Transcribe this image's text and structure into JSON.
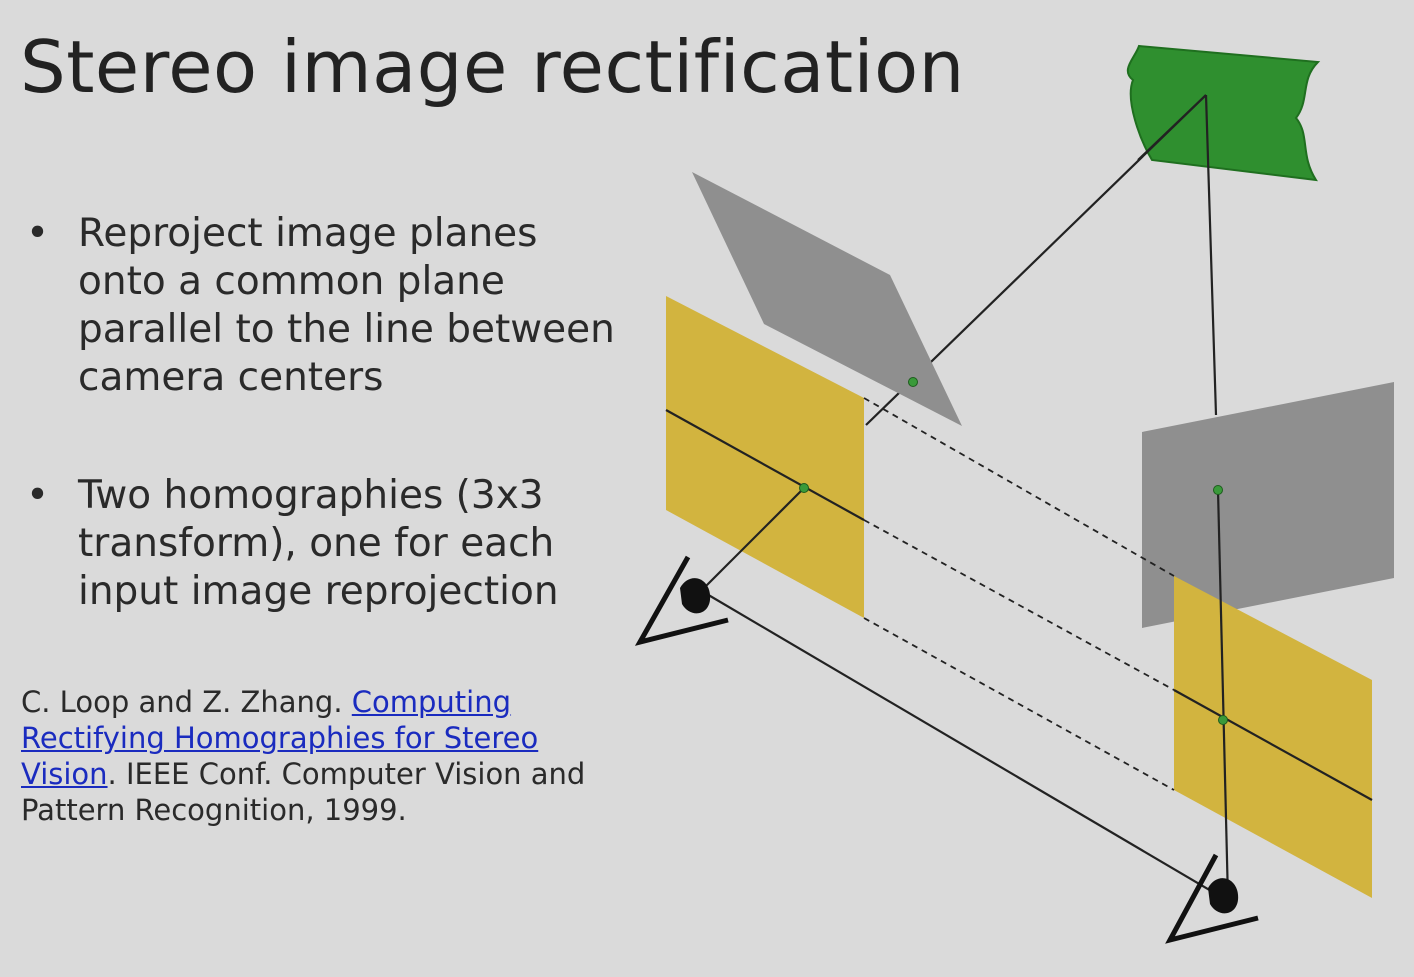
{
  "slide": {
    "title": "Stereo image rectification",
    "bullets": [
      "Reproject image planes onto a common plane parallel to the line between camera centers",
      "Two homographies (3x3 transform), one for each input image reprojection"
    ],
    "bullet_symbol": "•",
    "citation": {
      "authors": "C. Loop and Z. Zhang. ",
      "link_text": "Computing Rectifying Homographies for Stereo Vision",
      "venue": ". IEEE Conf. Computer Vision and Pattern Recognition, 1999."
    }
  },
  "colors": {
    "background": "#dadada",
    "yellow_plane": "#d2b43f",
    "gray_plane": "#8f8f8f",
    "green_object": "#2f8f2f",
    "link": "#1a2bbf",
    "point": "#3a9a3a"
  },
  "icons": {
    "left_camera": "eye-icon",
    "right_camera": "eye-icon"
  }
}
